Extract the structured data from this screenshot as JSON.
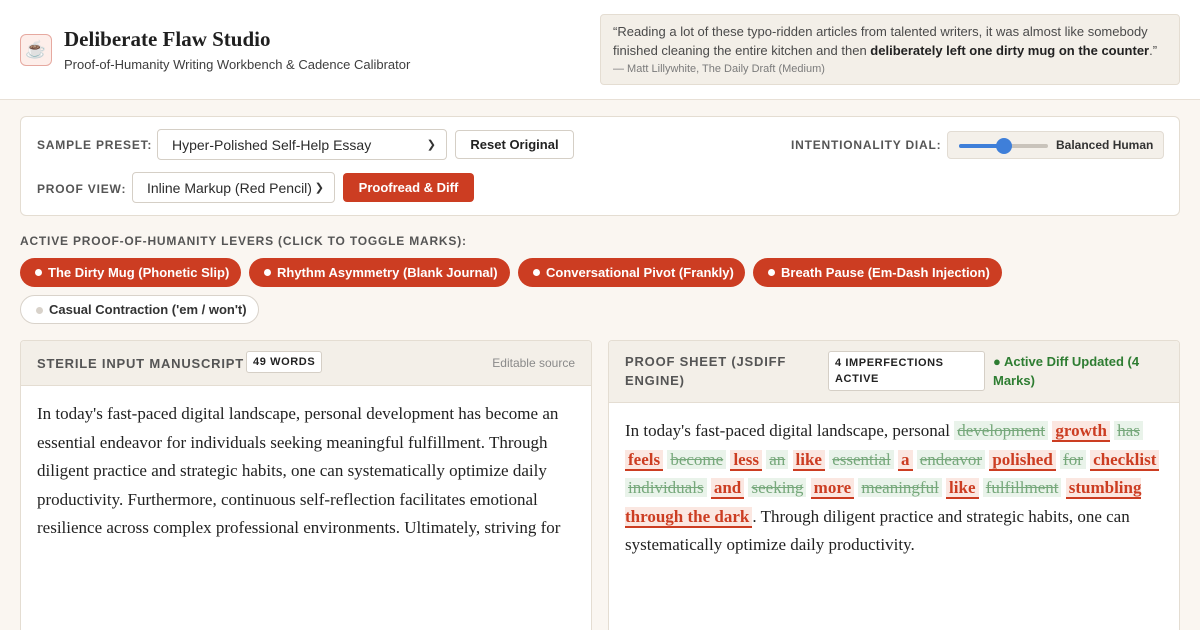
{
  "header": {
    "logo_icon": "coffee-mug-icon",
    "title": "Deliberate Flaw Studio",
    "subtitle": "Proof-of-Humanity Writing Workbench & Cadence Calibrator",
    "quote_open": "“Reading a lot of these typo-ridden articles from talented writers, it was almost like somebody finished cleaning the entire kitchen and then ",
    "quote_bold": "deliberately left one dirty mug on the counter",
    "quote_close": ".”",
    "quote_cite": "— Matt Lillywhite, The Daily Draft (Medium)"
  },
  "controls": {
    "preset_label": "SAMPLE PRESET:",
    "preset_value": "Hyper-Polished Self-Help Essay",
    "reset_label": "Reset Original",
    "dial_label": "INTENTIONALITY DIAL:",
    "dial_level": 0.5,
    "dial_value_label": "Balanced Human",
    "view_label": "PROOF VIEW:",
    "view_value": "Inline Markup (Red Pencil)",
    "proofread_label": "Proofread & Diff"
  },
  "levers": {
    "label": "ACTIVE PROOF-OF-HUMANITY LEVERS (CLICK TO TOGGLE MARKS):",
    "items": [
      {
        "label": "The Dirty Mug (Phonetic Slip)",
        "active": true
      },
      {
        "label": "Rhythm Asymmetry (Blank Journal)",
        "active": true
      },
      {
        "label": "Conversational Pivot (Frankly)",
        "active": true
      },
      {
        "label": "Breath Pause (Em-Dash Injection)",
        "active": true
      },
      {
        "label": "Casual Contraction ('em / won't)",
        "active": false
      }
    ]
  },
  "input_panel": {
    "title": "STERILE INPUT MANUSCRIPT",
    "word_count": "49 WORDS",
    "hint": "Editable source",
    "text": "In today's fast-paced digital landscape, personal development has become an essential endeavor for individuals seeking meaningful fulfillment. Through diligent practice and strategic habits, one can systematically optimize daily productivity. Furthermore, continuous self-reflection facilitates emotional resilience across complex professional environments. Ultimately, striving for"
  },
  "proof_panel": {
    "title": "PROOF SHEET (JSDIFF ENGINE)",
    "badge": "4 IMPERFECTIONS ACTIVE",
    "status": "● Active Diff Updated (4 Marks)",
    "status_color": "#2e7d32",
    "accent_color": "#cc3d22",
    "prefix": "In today's fast-paced digital landscape, personal",
    "diff": [
      {
        "del": "development",
        "ins": "growth"
      },
      {
        "del": "has",
        "ins": "feels"
      },
      {
        "del": "become",
        "ins": "less"
      },
      {
        "del": "an",
        "ins": "like"
      },
      {
        "del": "essential",
        "ins": "a"
      },
      {
        "del": "endeavor",
        "ins": "polished"
      },
      {
        "del": "for",
        "ins": "checklist"
      },
      {
        "del": "individuals",
        "ins": "and"
      },
      {
        "del": "seeking",
        "ins": "more"
      },
      {
        "del": "meaningful",
        "ins": "like"
      },
      {
        "del": "fulfillment",
        "ins": "stumbling through the dark"
      }
    ],
    "suffix": ". Through diligent practice and strategic habits, one can systematically optimize daily productivity."
  }
}
